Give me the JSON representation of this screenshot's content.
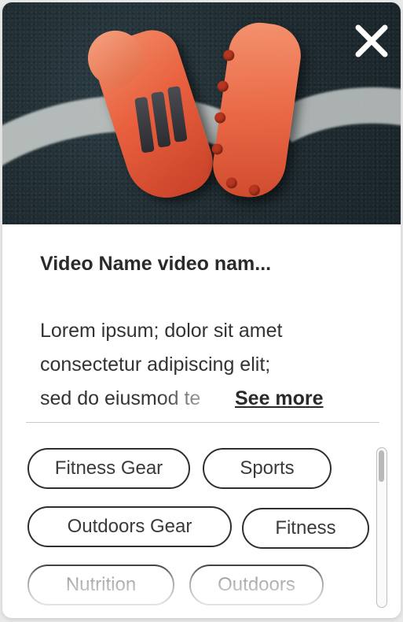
{
  "card": {
    "hero_image": "soccer-cleats-on-turf",
    "close_icon": "close-icon",
    "title": "Video Name video nam...",
    "description": {
      "line1": "Lorem ipsum; dolor sit amet",
      "line2": "consectetur adipiscing elit;",
      "line3": "sed do eiusmod te"
    },
    "see_more_label": "See more",
    "tags": [
      "Fitness Gear",
      "Sports",
      "Outdoors Gear",
      "Fitness",
      "Nutrition",
      "Outdoors"
    ]
  },
  "colors": {
    "accent": "#2f2f2f",
    "hero_background": "#1f2c31",
    "cleat_orange": "#e8603e"
  }
}
